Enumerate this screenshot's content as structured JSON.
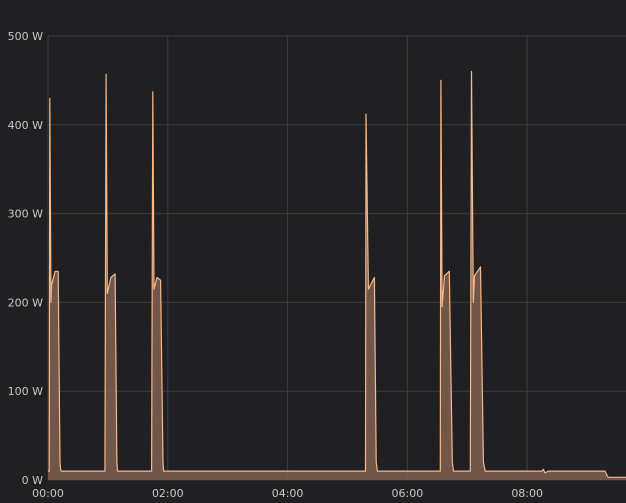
{
  "chart_data": {
    "type": "area",
    "title": "",
    "xlabel": "",
    "ylabel": "",
    "x_unit": "hours",
    "xlim": [
      0,
      9.65
    ],
    "ylim": [
      0,
      500
    ],
    "grid": true,
    "legend": "none",
    "y_ticks": [
      {
        "value": 0,
        "label": "0 W"
      },
      {
        "value": 100,
        "label": "100 W"
      },
      {
        "value": 200,
        "label": "200 W"
      },
      {
        "value": 300,
        "label": "300 W"
      },
      {
        "value": 400,
        "label": "400 W"
      },
      {
        "value": 500,
        "label": "500 W"
      }
    ],
    "x_ticks": [
      {
        "value": 0,
        "label": "00:00"
      },
      {
        "value": 2,
        "label": "02:00"
      },
      {
        "value": 4,
        "label": "04:00"
      },
      {
        "value": 6,
        "label": "06:00"
      },
      {
        "value": 8,
        "label": "08:00"
      }
    ],
    "colors": {
      "background": "#202022",
      "line": "#f4b98c",
      "fill": "#806050",
      "grid": "#3c3c3e",
      "text": "#c8c8c8"
    },
    "series": [
      {
        "x": [
          0.0,
          0.02,
          0.03,
          0.05,
          0.06,
          0.08,
          0.12,
          0.17,
          0.2,
          0.21,
          0.22,
          0.25,
          0.9,
          0.95,
          0.97,
          0.99,
          1.05,
          1.12,
          1.15,
          1.16,
          1.2,
          1.68,
          1.73,
          1.75,
          1.77,
          1.82,
          1.88,
          1.92,
          1.93,
          1.95,
          5.2,
          5.3,
          5.31,
          5.35,
          5.45,
          5.48,
          5.5,
          5.52,
          6.5,
          6.55,
          6.56,
          6.58,
          6.62,
          6.7,
          6.75,
          6.77,
          6.8,
          7.05,
          7.07,
          7.1,
          7.12,
          7.22,
          7.27,
          7.3,
          7.32,
          7.35,
          8.0,
          8.25,
          8.27,
          8.3,
          8.35,
          8.45,
          9.0,
          9.3,
          9.35,
          9.4,
          9.65
        ],
        "y": [
          10,
          10,
          430,
          200,
          220,
          225,
          235,
          235,
          20,
          12,
          10,
          10,
          10,
          10,
          457,
          210,
          228,
          232,
          20,
          10,
          10,
          10,
          10,
          437,
          215,
          228,
          225,
          20,
          10,
          10,
          10,
          10,
          412,
          215,
          228,
          20,
          10,
          10,
          10,
          10,
          450,
          195,
          230,
          235,
          20,
          10,
          10,
          10,
          460,
          200,
          230,
          240,
          20,
          10,
          10,
          10,
          10,
          10,
          12,
          8,
          10,
          10,
          10,
          10,
          3,
          3,
          3
        ]
      }
    ]
  }
}
